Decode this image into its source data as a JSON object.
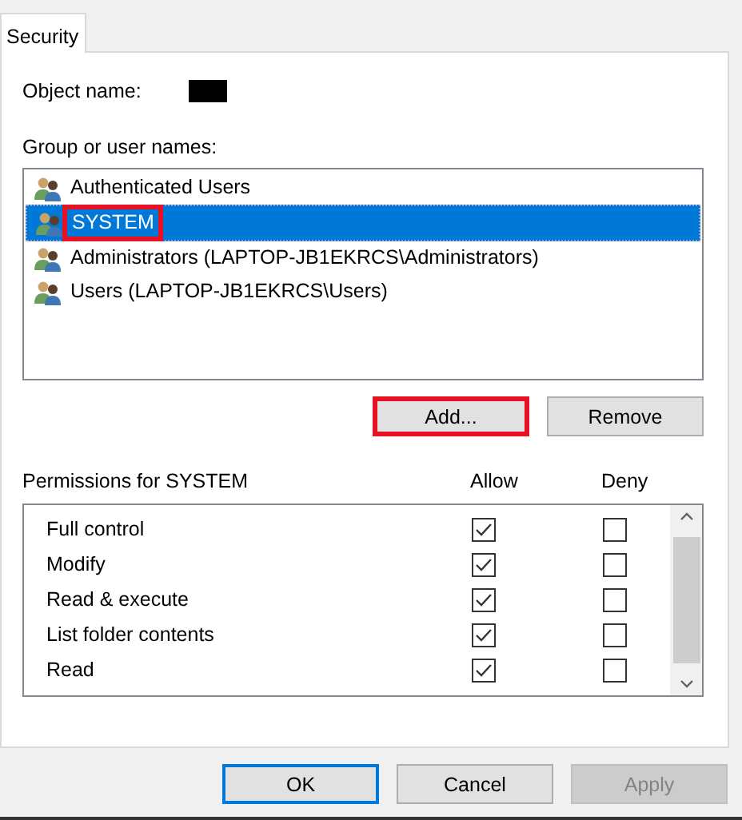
{
  "tabs": [
    {
      "label": "Security",
      "selected": true
    }
  ],
  "object_name": {
    "label": "Object name:",
    "redacted": true
  },
  "group_label": "Group or user names:",
  "users": [
    {
      "name": "Authenticated Users",
      "selected": false,
      "highlighted": false
    },
    {
      "name": "SYSTEM",
      "selected": true,
      "highlighted": true
    },
    {
      "name": "Administrators (LAPTOP-JB1EKRCS\\Administrators)",
      "selected": false,
      "highlighted": false
    },
    {
      "name": "Users (LAPTOP-JB1EKRCS\\Users)",
      "selected": false,
      "highlighted": false
    }
  ],
  "user_buttons": [
    {
      "label": "Add...",
      "highlighted": true
    },
    {
      "label": "Remove",
      "highlighted": false
    }
  ],
  "permissions": {
    "title": "Permissions for SYSTEM",
    "columns": [
      "Allow",
      "Deny"
    ],
    "rows": [
      {
        "name": "Full control",
        "allow": true,
        "deny": false
      },
      {
        "name": "Modify",
        "allow": true,
        "deny": false
      },
      {
        "name": "Read & execute",
        "allow": true,
        "deny": false
      },
      {
        "name": "List folder contents",
        "allow": true,
        "deny": false
      },
      {
        "name": "Read",
        "allow": true,
        "deny": false
      }
    ]
  },
  "footer_buttons": [
    {
      "label": "OK",
      "default": true,
      "disabled": false
    },
    {
      "label": "Cancel",
      "default": false,
      "disabled": false
    },
    {
      "label": "Apply",
      "default": false,
      "disabled": true
    }
  ]
}
